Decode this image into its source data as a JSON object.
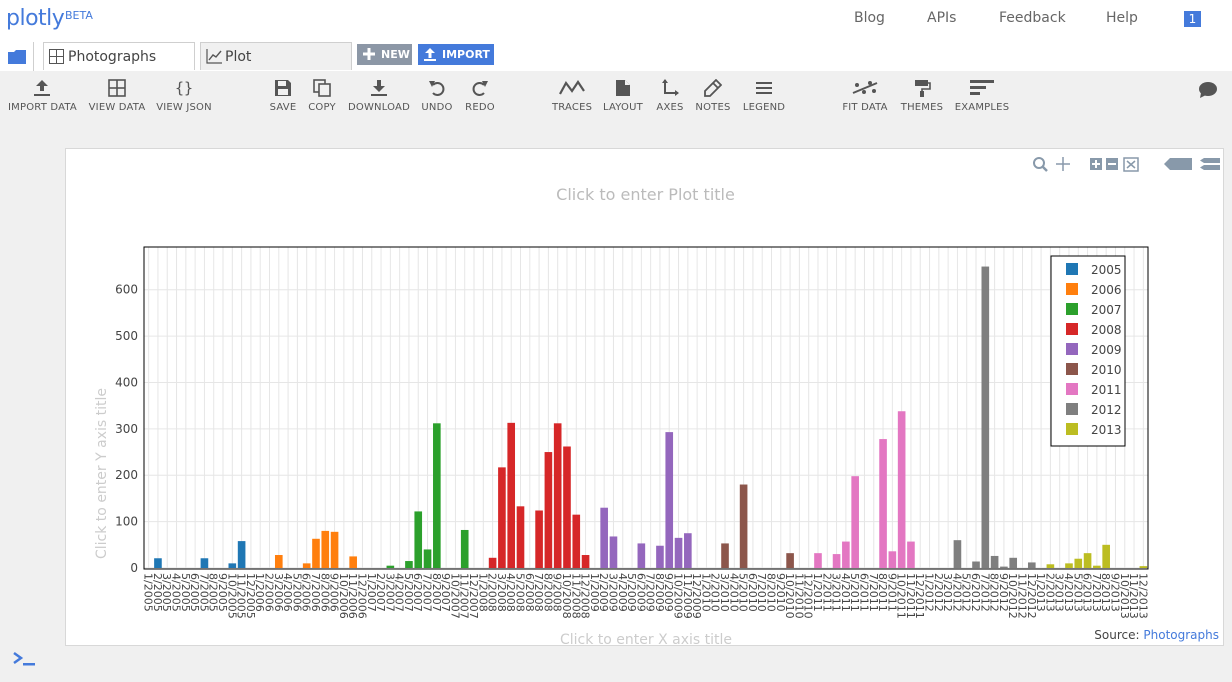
{
  "header": {
    "logo": "plotly",
    "logo_badge": "BETA",
    "links": [
      "Blog",
      "APIs",
      "Feedback",
      "Help"
    ],
    "notification_count": "1"
  },
  "tabs": [
    {
      "label": "Photographs",
      "icon": "grid-icon"
    },
    {
      "label": "Plot",
      "icon": "line-chart-icon"
    }
  ],
  "tab_buttons": {
    "new_label": "NEW",
    "import_label": "IMPORT"
  },
  "toolbar": {
    "import_data": "IMPORT DATA",
    "view_data": "VIEW DATA",
    "view_json": "VIEW JSON",
    "save": "SAVE",
    "copy": "COPY",
    "download": "DOWNLOAD",
    "undo": "UNDO",
    "redo": "REDO",
    "traces": "TRACES",
    "layout": "LAYOUT",
    "axes": "AXES",
    "notes": "NOTES",
    "legend": "LEGEND",
    "fit_data": "FIT DATA",
    "themes": "THEMES",
    "examples": "EXAMPLES"
  },
  "plot": {
    "title_placeholder": "Click to enter Plot title",
    "source_label": "Source:",
    "source_link": "Photographs"
  },
  "chart_data": {
    "type": "bar",
    "title": "Click to enter Plot title",
    "xlabel": "Click to enter X axis title",
    "ylabel": "Click to enter Y axis title",
    "ylim": [
      0,
      690
    ],
    "yticks": [
      0,
      100,
      200,
      300,
      400,
      500,
      600
    ],
    "grid": true,
    "legend_position": "top-right",
    "colors": [
      "#1f77b4",
      "#ff7f0e",
      "#2ca02c",
      "#d62728",
      "#9467bd",
      "#8c564b",
      "#e377c2",
      "#7f7f7f",
      "#bcbd22"
    ],
    "series": [
      {
        "name": "2005",
        "x": [
          "1/2005",
          "2/2005",
          "3/2005",
          "4/2005",
          "5/2005",
          "6/2005",
          "7/2005",
          "8/2005",
          "9/2005",
          "10/2005",
          "11/2005",
          "12/2005"
        ],
        "values": [
          0,
          21,
          0,
          0,
          0,
          0,
          21,
          0,
          0,
          10,
          58,
          0
        ]
      },
      {
        "name": "2006",
        "x": [
          "1/2006",
          "2/2006",
          "3/2006",
          "4/2006",
          "5/2006",
          "6/2006",
          "7/2006",
          "8/2006",
          "9/2006",
          "10/2006",
          "11/2006",
          "12/2006"
        ],
        "values": [
          0,
          0,
          28,
          0,
          0,
          10,
          63,
          80,
          78,
          0,
          25,
          0
        ]
      },
      {
        "name": "2007",
        "x": [
          "1/2007",
          "2/2007",
          "3/2007",
          "4/2007",
          "5/2007",
          "6/2007",
          "7/2007",
          "8/2007",
          "9/2007",
          "10/2007",
          "11/2007",
          "12/2007"
        ],
        "values": [
          0,
          0,
          5,
          0,
          15,
          122,
          40,
          312,
          0,
          0,
          82,
          0
        ]
      },
      {
        "name": "2008",
        "x": [
          "1/2008",
          "2/2008",
          "3/2008",
          "4/2008",
          "5/2008",
          "6/2008",
          "7/2008",
          "8/2008",
          "9/2008",
          "10/2008",
          "11/2008",
          "12/2008"
        ],
        "values": [
          0,
          22,
          217,
          313,
          133,
          0,
          124,
          250,
          312,
          262,
          115,
          28
        ]
      },
      {
        "name": "2009",
        "x": [
          "1/2009",
          "2/2009",
          "3/2009",
          "4/2009",
          "5/2009",
          "6/2009",
          "7/2009",
          "8/2009",
          "9/2009",
          "10/2009",
          "11/2009",
          "12/2009"
        ],
        "values": [
          0,
          130,
          68,
          0,
          0,
          53,
          0,
          48,
          293,
          65,
          75,
          0
        ]
      },
      {
        "name": "2010",
        "x": [
          "1/2010",
          "2/2010",
          "3/2010",
          "4/2010",
          "5/2010",
          "6/2010",
          "7/2010",
          "8/2010",
          "9/2010",
          "10/2010",
          "11/2010",
          "12/2010"
        ],
        "values": [
          0,
          0,
          53,
          0,
          180,
          0,
          0,
          0,
          0,
          32,
          0,
          0
        ]
      },
      {
        "name": "2011",
        "x": [
          "1/2011",
          "2/2011",
          "3/2011",
          "4/2011",
          "5/2011",
          "6/2011",
          "7/2011",
          "8/2011",
          "9/2011",
          "10/2011",
          "11/2011",
          "12/2011"
        ],
        "values": [
          32,
          0,
          30,
          57,
          198,
          0,
          0,
          278,
          36,
          338,
          57,
          0
        ]
      },
      {
        "name": "2012",
        "x": [
          "1/2012",
          "2/2012",
          "3/2012",
          "4/2012",
          "5/2012",
          "6/2012",
          "7/2012",
          "8/2012",
          "9/2012",
          "10/2012",
          "11/2012",
          "12/2012"
        ],
        "values": [
          0,
          0,
          0,
          60,
          0,
          14,
          650,
          26,
          3,
          22,
          0,
          12
        ]
      },
      {
        "name": "2013",
        "x": [
          "1/2013",
          "2/2013",
          "3/2013",
          "4/2013",
          "5/2013",
          "6/2013",
          "7/2013",
          "8/2013",
          "9/2013",
          "10/2013",
          "11/2013",
          "12/2013"
        ],
        "values": [
          0,
          8,
          0,
          10,
          20,
          32,
          5,
          50,
          0,
          0,
          0,
          4
        ]
      }
    ]
  }
}
